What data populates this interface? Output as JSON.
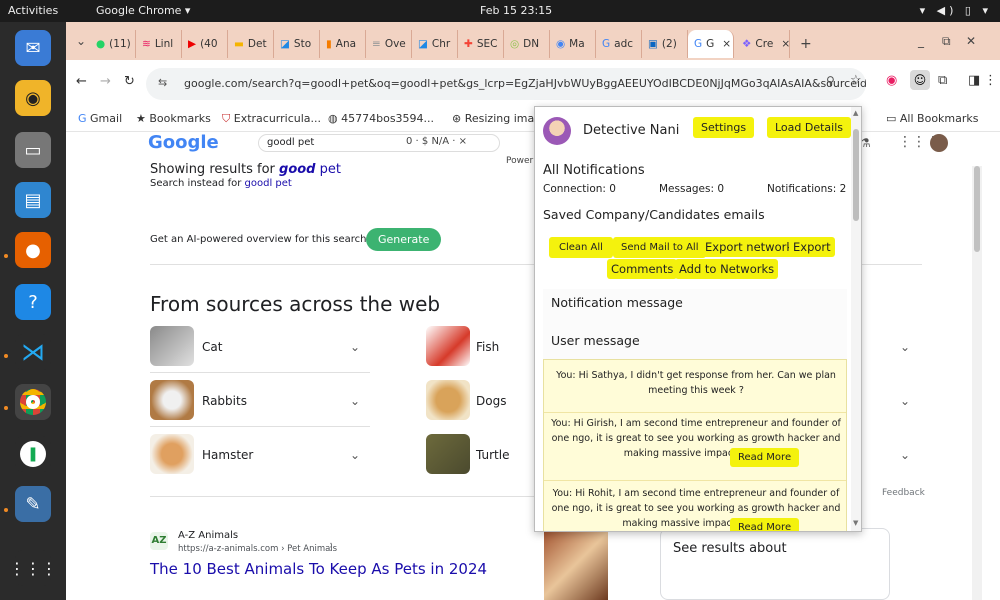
{
  "system": {
    "activities": "Activities",
    "app_name": "Google Chrome ▾",
    "clock": "Feb 15  23:15",
    "indicators": "▾ ◀) ▯ ▾"
  },
  "dock": {
    "items": [
      "thunderbird-icon",
      "rhythmbox-icon",
      "files-icon",
      "writer-icon",
      "firefox-icon",
      "help-icon",
      "vscode-icon",
      "chrome-icon",
      "mongodb-icon",
      "editor-icon",
      "apps-grid-icon"
    ]
  },
  "tabs": [
    {
      "label": "(11)"
    },
    {
      "label": "Linl"
    },
    {
      "label": "(40"
    },
    {
      "label": "Det"
    },
    {
      "label": "Sto"
    },
    {
      "label": "Ana"
    },
    {
      "label": "Ove"
    },
    {
      "label": "Chr"
    },
    {
      "label": "SEC"
    },
    {
      "label": "DN"
    },
    {
      "label": "Ma"
    },
    {
      "label": "adc"
    },
    {
      "label": "(2)"
    },
    {
      "label": "G"
    },
    {
      "label": "Cre"
    }
  ],
  "toolbar": {
    "url": "google.com/search?q=goodl+pet&oq=goodl+pet&gs_lcrp=EgZjaHJvbWUyBggAEEUYOdIBCDE0NjJqMGo3qAIAsAIA&sourceid=c..."
  },
  "bookmarks": [
    {
      "label": "Gmail"
    },
    {
      "label": "Bookmarks"
    },
    {
      "label": "Extracurricula..."
    },
    {
      "label": "45774bos3594..."
    },
    {
      "label": "Resizing imag..."
    },
    {
      "label": "All Bookmarks"
    }
  ],
  "google": {
    "logo": "Google",
    "search_value": "goodl pet",
    "search_meta": "0 · $ N/A · ×",
    "powered": "Power",
    "showing_prefix": "Showing results for ",
    "showing_bold": "good",
    "showing_suffix": " pet",
    "instead_prefix": "Search instead for ",
    "instead_link": "goodl pet",
    "ai_prompt": "Get an AI-powered overview for this search?",
    "generate": "Generate",
    "sources_heading": "From sources across the web",
    "cards": [
      {
        "label": "Cat"
      },
      {
        "label": "Fish"
      },
      {
        "label": "Rabbits"
      },
      {
        "label": "Dogs"
      },
      {
        "label": "Hamster"
      },
      {
        "label": "Turtle"
      }
    ],
    "feedback": "Feedback",
    "result_site": "A-Z Animals",
    "result_url": "https://a-z-animals.com › Pet Animals",
    "result_title": "The 10 Best Animals To Keep As Pets in 2024",
    "see_results": "See results about"
  },
  "popup": {
    "name": "Detective Nani",
    "settings": "Settings",
    "load_details": "Load Details",
    "all_notifications": "All Notifications",
    "connection": "Connection: 0",
    "messages": "Messages: 0",
    "notifications": "Notifications: 2",
    "saved_heading": "Saved Company/Candidates emails",
    "clean_all": "Clean All",
    "send_mail": "Send Mail to All",
    "export_network": "Export network",
    "export_comments_1": "Export",
    "export_comments_2": "Comments",
    "add_networks": "Add to Networks",
    "notification_message": "Notification message",
    "user_message": "User message",
    "messages_list": [
      {
        "text": "You: Hi Sathya, I didn't get response from her. Can we plan meeting this week ?"
      },
      {
        "text": "You: Hi Girish, I am second time entrepreneur and founder of one ngo, it is great to see you working as growth hacker and making massive impact. I wou"
      },
      {
        "text": "You: Hi Rohit, I am second time entrepreneur and founder of one ngo, it is great to see you working as growth hacker and making massive impact. I woul"
      }
    ],
    "read_more": "Read More"
  }
}
